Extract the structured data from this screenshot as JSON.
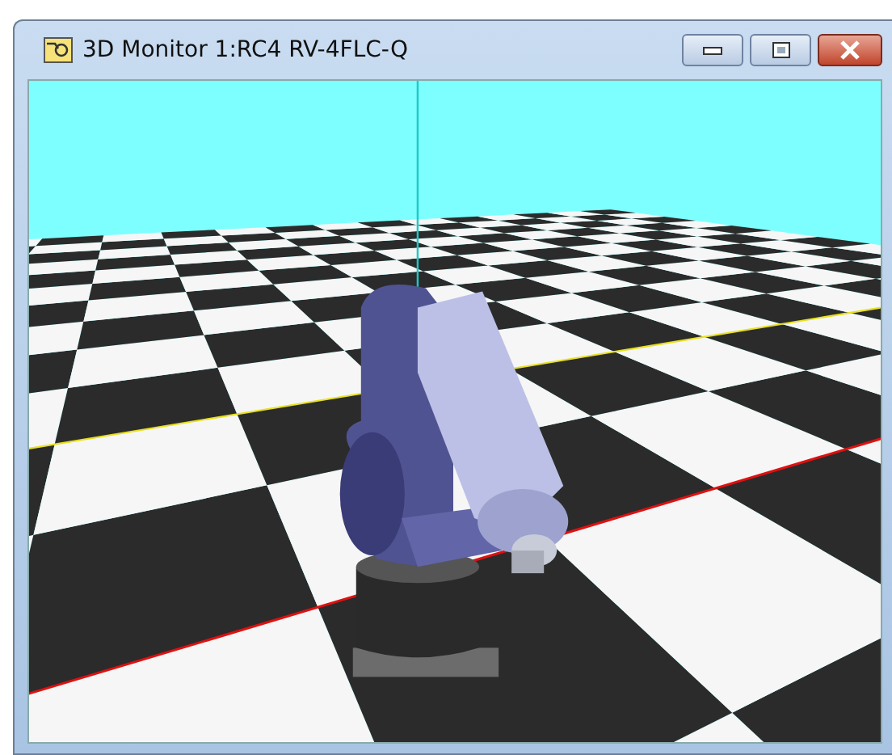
{
  "window": {
    "title": "3D Monitor 1:RC4 RV-4FLC-Q"
  }
}
